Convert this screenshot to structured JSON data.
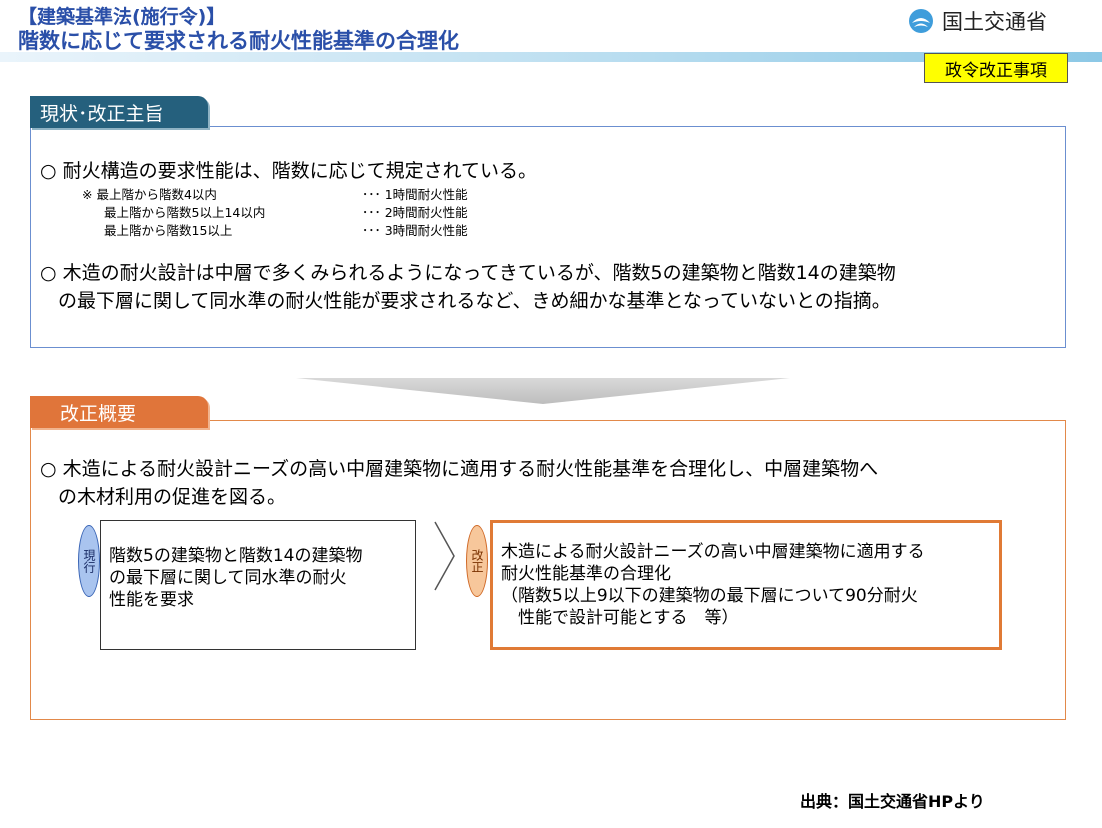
{
  "header": {
    "line1": "【建築基準法(施行令)】",
    "line2": "階数に応じて要求される耐火性能基準の合理化",
    "ministry": "国土交通省",
    "badge": "政令改正事項"
  },
  "section_current": {
    "tab_label": "現状･改正主旨",
    "bullet1": "○ 耐火構造の要求性能は、階数に応じて規定されている。",
    "rows": [
      {
        "left": "※ 最上階から階数4以内",
        "right": "･･･ 1時間耐火性能"
      },
      {
        "left": "最上階から階数5以上14以内",
        "right": "･･･ 2時間耐火性能"
      },
      {
        "left": "最上階から階数15以上",
        "right": "･･･ 3時間耐火性能"
      }
    ],
    "bullet2_line1": "○ 木造の耐火設計は中層で多くみられるようになってきているが、階数5の建築物と階数14の建築物",
    "bullet2_line2": "の最下層に関して同水準の耐火性能が要求されるなど、きめ細かな基準となっていないとの指摘。"
  },
  "section_summary": {
    "tab_label": "改正概要",
    "bullet_line1": "○ 木造による耐火設計ニーズの高い中層建築物に適用する耐火性能基準を合理化し、中層建築物へ",
    "bullet_line2": "の木材利用の促進を図る。",
    "current_label": "現行",
    "current_lines": [
      "階数5の建築物と階数14の建築物",
      "の最下層に関して同水準の耐火",
      "性能を要求"
    ],
    "revised_label": "改正",
    "revised_lines": [
      "木造による耐火設計ニーズの高い中層建築物に適用する",
      "耐火性能基準の合理化",
      "（階数5以上9以下の建築物の最下層について90分耐火",
      "　性能で設計可能とする　等）"
    ]
  },
  "source": "出典：国土交通省HPより",
  "colors": {
    "title_blue": "#2a4fa8",
    "tab_teal": "#25607d",
    "tab_orange": "#e0753a",
    "badge_yellow": "#ffff00"
  }
}
